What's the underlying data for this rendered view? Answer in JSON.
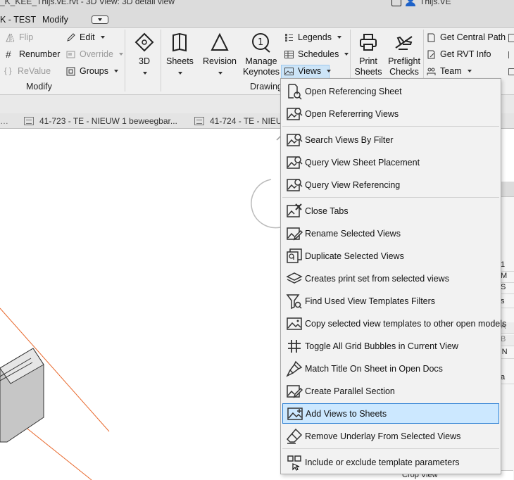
{
  "title_bar": {
    "text": "_K_KEE_Thijs.vE.rvt - 3D View: 3D detail view",
    "user": "Thijs.VE"
  },
  "menu_bar": {
    "project": "K - TEST",
    "modify": "Modify"
  },
  "ribbon": {
    "modify_panel": {
      "flip": "Flip",
      "renumber": "Renumber",
      "revalue": "ReValue",
      "edit": "Edit",
      "override": "Override",
      "groups": "Groups",
      "label": "Modify"
    },
    "big_buttons": {
      "three_d": "3D",
      "sheets": "Sheets",
      "revision": "Revision",
      "manage_keynotes": [
        "Manage",
        "Keynotes"
      ],
      "print_sheets": [
        "Print",
        "Sheets"
      ],
      "preflight_checks": [
        "Preflight",
        "Checks"
      ]
    },
    "drawing_panel": {
      "legends": "Legends",
      "schedules": "Schedules",
      "views": "Views",
      "label": "Drawing"
    },
    "right_panel": {
      "get_central_path": "Get Central Path",
      "get_rvt_info": "Get RVT Info",
      "team": "Team"
    }
  },
  "tabs": [
    {
      "label": "41-723 - TE - NIEUW 1 beweegbar..."
    },
    {
      "label": "41-724 - TE - NIEU"
    }
  ],
  "views_menu": {
    "items": [
      {
        "label": "Open Referencing Sheet",
        "icon": "sheet-reference-icon"
      },
      {
        "label": "Open Refererring Views",
        "icon": "view-search-icon"
      },
      {
        "label": "Search Views By Filter",
        "icon": "view-search-icon"
      },
      {
        "label": "Query View Sheet Placement",
        "icon": "view-search-icon"
      },
      {
        "label": "Query View Referencing",
        "icon": "view-search-icon"
      },
      {
        "label": "Close Tabs",
        "icon": "close-view-icon"
      },
      {
        "label": "Rename Selected Views",
        "icon": "rename-view-icon"
      },
      {
        "label": "Duplicate Selected Views",
        "icon": "duplicate-view-icon"
      },
      {
        "label": "Creates print set from selected views",
        "icon": "layers-icon"
      },
      {
        "label": "Find Used View Templates Filters",
        "icon": "filter-icon"
      },
      {
        "label": "Copy selected view templates to other open models",
        "icon": "image-view-icon"
      },
      {
        "label": "Toggle All Grid Bubbles in Current View",
        "icon": "grid-icon"
      },
      {
        "label": "Match Title On Sheet in Open Docs",
        "icon": "paintbrush-icon"
      },
      {
        "label": "Create Parallel Section",
        "icon": "view-edit-icon"
      },
      {
        "label": "Add Views to Sheets",
        "icon": "add-view-icon",
        "selected": true
      },
      {
        "label": "Remove Underlay From Selected Views",
        "icon": "eraser-icon"
      },
      {
        "label": "Include or exclude template parameters",
        "icon": "template-parameters-icon"
      }
    ]
  },
  "right_props": {
    "cells": [
      "1",
      "M",
      "S",
      "s",
      "A",
      "B",
      "le N",
      "a",
      "Crop View"
    ]
  },
  "colors": {
    "selection_bg": "#cce8ff",
    "selection_border": "#2a7fd4",
    "section_line": "#e8682c"
  }
}
